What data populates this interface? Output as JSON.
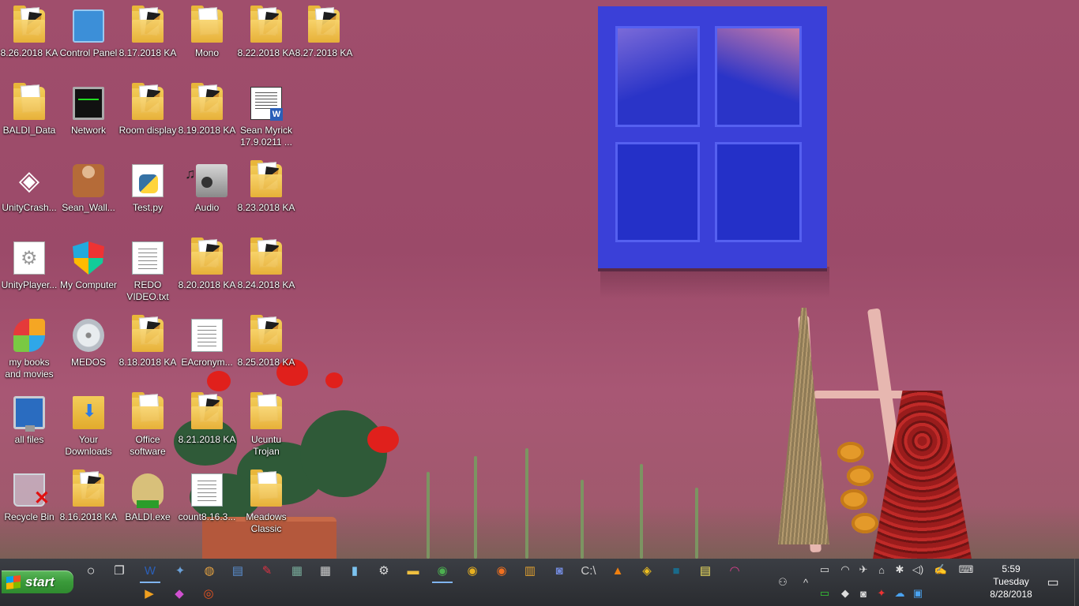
{
  "desktop": {
    "icons": [
      {
        "label": "8.26.2018 KA",
        "type": "folder"
      },
      {
        "label": "Control Panel",
        "type": "control-panel"
      },
      {
        "label": "8.17.2018 KA",
        "type": "folder"
      },
      {
        "label": "Mono",
        "type": "folder-plain"
      },
      {
        "label": "8.22.2018 KA",
        "type": "folder"
      },
      {
        "label": "8.27.2018 KA",
        "type": "folder"
      },
      {
        "label": "BALDI_Data",
        "type": "folder-plain"
      },
      {
        "label": "Network",
        "type": "network"
      },
      {
        "label": "Room display",
        "type": "folder"
      },
      {
        "label": "8.19.2018 KA",
        "type": "folder"
      },
      {
        "label": "Sean Myrick 17.9.0211 ...",
        "type": "word-doc"
      },
      {
        "label": "UnityCrash...",
        "type": "unity"
      },
      {
        "label": "Sean_Wall...",
        "type": "person"
      },
      {
        "label": "Test.py",
        "type": "python"
      },
      {
        "label": "Audio",
        "type": "speaker"
      },
      {
        "label": "8.23.2018 KA",
        "type": "folder"
      },
      {
        "label": "UnityPlayer...",
        "type": "gear-doc"
      },
      {
        "label": "My Computer",
        "type": "shield"
      },
      {
        "label": "REDO VIDEO.txt",
        "type": "text-doc"
      },
      {
        "label": "8.20.2018 KA",
        "type": "folder"
      },
      {
        "label": "8.24.2018 KA",
        "type": "folder"
      },
      {
        "label": "my books and movies",
        "type": "butterfly"
      },
      {
        "label": "MEDOS",
        "type": "cd"
      },
      {
        "label": "8.18.2018 KA",
        "type": "folder"
      },
      {
        "label": "EAcronym...",
        "type": "text-doc"
      },
      {
        "label": "8.25.2018 KA",
        "type": "folder"
      },
      {
        "label": "all files",
        "type": "monitor"
      },
      {
        "label": "Your Downloads",
        "type": "downloads"
      },
      {
        "label": "Office software",
        "type": "folder-plain"
      },
      {
        "label": "8.21.2018 KA",
        "type": "folder"
      },
      {
        "label": "Ucuntu Trojan",
        "type": "folder-plain"
      },
      {
        "label": "Recycle Bin",
        "type": "recycle"
      },
      {
        "label": "8.16.2018 KA",
        "type": "folder"
      },
      {
        "label": "BALDI.exe",
        "type": "baldi"
      },
      {
        "label": "count8.16.3...",
        "type": "text-doc"
      },
      {
        "label": "Meadows Classic",
        "type": "folder-plain"
      }
    ]
  },
  "taskbar": {
    "start_label": "start",
    "pinned": [
      {
        "name": "cortana",
        "glyph": "○"
      },
      {
        "name": "task-view",
        "glyph": "❐"
      },
      {
        "name": "word",
        "glyph": "W",
        "color": "#2b5fb8",
        "active": true
      },
      {
        "name": "app-2",
        "glyph": "✦",
        "color": "#6aa0d8"
      },
      {
        "name": "paint",
        "glyph": "◍",
        "color": "#e2a040"
      },
      {
        "name": "app-4",
        "glyph": "▤",
        "color": "#5b8fd0"
      },
      {
        "name": "app-5",
        "glyph": "✎",
        "color": "#d34"
      },
      {
        "name": "app-6",
        "glyph": "▦",
        "color": "#7a9"
      },
      {
        "name": "calculator",
        "glyph": "▦",
        "color": "#ccc"
      },
      {
        "name": "notepad",
        "glyph": "▮",
        "color": "#7cc3f0"
      },
      {
        "name": "settings",
        "glyph": "⚙",
        "color": "#ddd"
      },
      {
        "name": "file-explorer",
        "glyph": "▬",
        "color": "#f0c040"
      },
      {
        "name": "chrome",
        "glyph": "◉",
        "color": "#4caf50",
        "active": true
      },
      {
        "name": "chrome-2",
        "glyph": "◉",
        "color": "#e8b020"
      },
      {
        "name": "firefox",
        "glyph": "◉",
        "color": "#f07020"
      },
      {
        "name": "app-15",
        "glyph": "▥",
        "color": "#e0a030"
      },
      {
        "name": "discord",
        "glyph": "◙",
        "color": "#7289da"
      },
      {
        "name": "command-prompt",
        "glyph": "C:\\",
        "color": "#ccc"
      },
      {
        "name": "vlc",
        "glyph": "▲",
        "color": "#f08010"
      },
      {
        "name": "app-19",
        "glyph": "◈",
        "color": "#f0c020"
      },
      {
        "name": "app-20",
        "glyph": "■",
        "color": "#1a6a8a"
      },
      {
        "name": "notes",
        "glyph": "▤",
        "color": "#f0e060"
      },
      {
        "name": "app-22",
        "glyph": "◠",
        "color": "#e04090"
      }
    ],
    "second_row": [
      {
        "name": "media-player",
        "glyph": "▶",
        "color": "#f0a020"
      },
      {
        "name": "maps",
        "glyph": "◆",
        "color": "#d050d0"
      },
      {
        "name": "ubuntu",
        "glyph": "◎",
        "color": "#e95420"
      }
    ],
    "tray_top": [
      {
        "name": "people-icon",
        "glyph": "⚇"
      },
      {
        "name": "show-hidden-icon",
        "glyph": "^"
      },
      {
        "name": "tray-monitor-icon",
        "glyph": "▭"
      },
      {
        "name": "wifi-icon",
        "glyph": "◠"
      },
      {
        "name": "tray-app-icon",
        "glyph": "✈"
      },
      {
        "name": "lock-icon",
        "glyph": "⌂"
      },
      {
        "name": "bluetooth-icon",
        "glyph": "✱"
      },
      {
        "name": "volume-icon",
        "glyph": "◁)"
      },
      {
        "name": "pen-icon",
        "glyph": "✍"
      },
      {
        "name": "keyboard-icon",
        "glyph": "⌨"
      }
    ],
    "tray_bottom": [
      {
        "name": "battery-icon",
        "glyph": "▭",
        "color": "#3c3"
      },
      {
        "name": "defender-icon",
        "glyph": "◆",
        "color": "#ddd"
      },
      {
        "name": "discord-tray-icon",
        "glyph": "◙",
        "color": "#ddd"
      },
      {
        "name": "tray-red-icon",
        "glyph": "✦",
        "color": "#e33"
      },
      {
        "name": "onedrive-icon",
        "glyph": "☁",
        "color": "#4aa3f0"
      },
      {
        "name": "tray-blue-icon",
        "glyph": "▣",
        "color": "#4aa3f0"
      }
    ],
    "clock": {
      "time": "5:59",
      "day": "Tuesday",
      "date": "8/28/2018"
    }
  }
}
